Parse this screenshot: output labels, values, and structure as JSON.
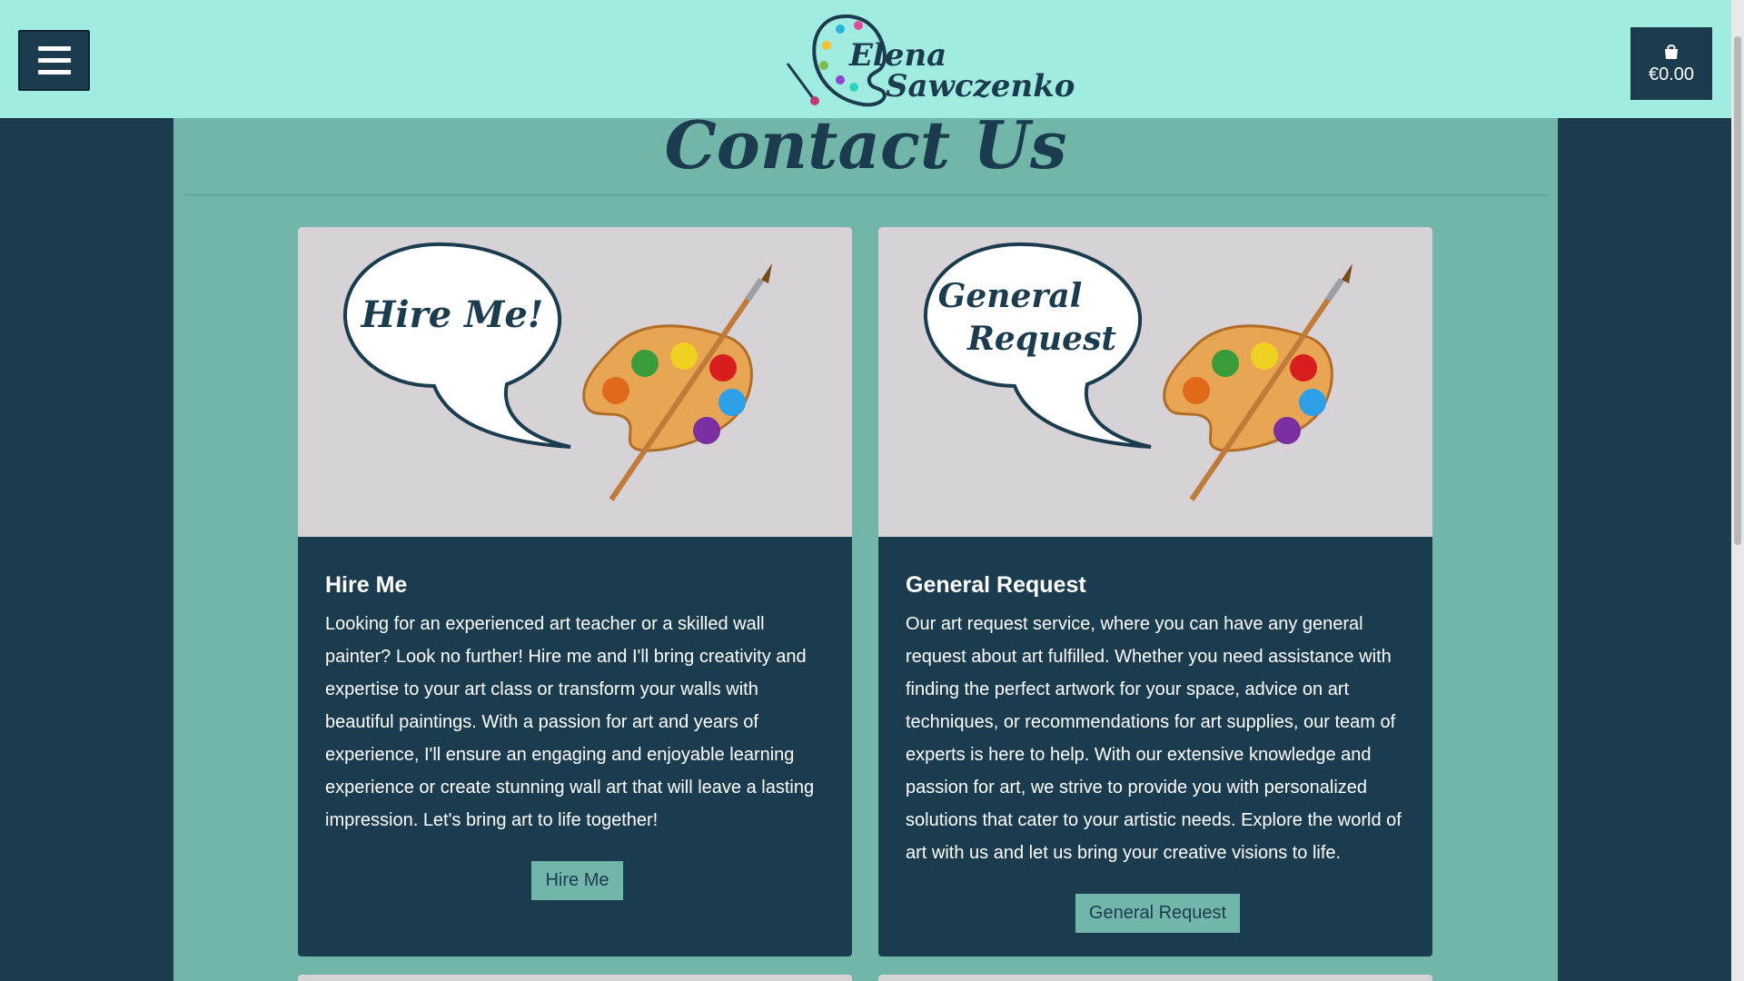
{
  "header": {
    "menu_label": "",
    "logo": {
      "line1": "Elena",
      "line2": "Sawczenko"
    },
    "cart": {
      "amount": "€0.00"
    }
  },
  "main": {
    "title": "Contact Us",
    "cards": [
      {
        "image_text_line1": "Hire Me!",
        "image_text_line2": "",
        "heading": "Hire Me",
        "text": "Looking for an experienced art teacher or a skilled wall painter? Look no further! Hire me and I'll bring creativity and expertise to your art class or transform your walls with beautiful paintings. With a passion for art and years of experience, I'll ensure an engaging and enjoyable learning experience or create stunning wall art that will leave a lasting impression. Let's bring art to life together!",
        "button": "Hire Me"
      },
      {
        "image_text_line1": "General",
        "image_text_line2": "Request",
        "heading": "General Request",
        "text": "Our art request service, where you can have any general request about art fulfilled. Whether you need assistance with finding the perfect artwork for your space, advice on art techniques, or recommendations for art supplies, our team of experts is here to help. With our extensive knowledge and passion for art, we strive to provide you with personalized solutions that cater to your artistic needs. Explore the world of art with us and let us bring your creative visions to life.",
        "button": "General Request"
      }
    ]
  },
  "colors": {
    "header_bg": "#a0ece0",
    "dark_navy": "#1b3b4f",
    "teal_panel": "#72b6aa",
    "image_bg": "#d6d2d6"
  },
  "icons": [
    "hamburger-menu-icon",
    "shopping-bag-icon",
    "palette-icon",
    "paintbrush-icon",
    "speech-bubble-icon"
  ]
}
